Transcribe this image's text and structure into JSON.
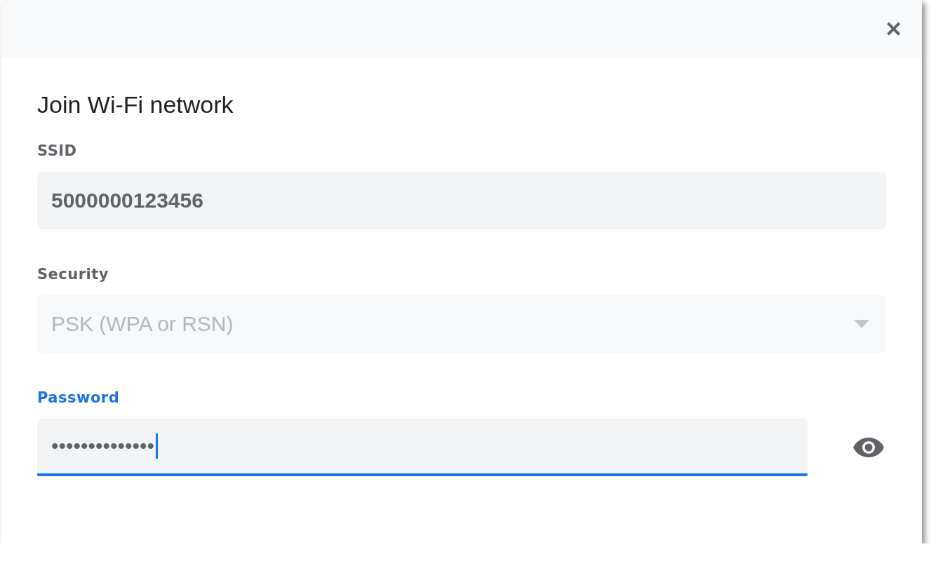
{
  "dialog": {
    "title": "Join Wi-Fi network",
    "close_label": "✕"
  },
  "fields": [
    {
      "kind": "text",
      "label": "SSID",
      "value": "5000000123456",
      "disabled": false,
      "focused": false
    },
    {
      "kind": "select",
      "label": "Security",
      "value": "PSK (WPA or RSN)",
      "disabled": true,
      "focused": false
    },
    {
      "kind": "password",
      "label": "Password",
      "value": "••••••••••••••",
      "disabled": false,
      "focused": true
    }
  ]
}
